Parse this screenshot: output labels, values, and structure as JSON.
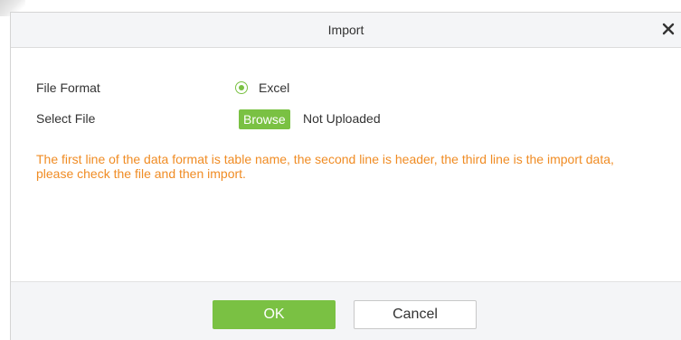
{
  "dialog": {
    "title": "Import",
    "close_icon": "close-icon"
  },
  "form": {
    "file_format_label": "File Format",
    "file_format_option": "Excel",
    "file_format_selected": true,
    "select_file_label": "Select File",
    "browse_label": "Browse",
    "upload_status": "Not Uploaded"
  },
  "notice": "The first line of the data format is table name, the second line is header, the third line is the import data, please check the file and then import.",
  "footer": {
    "ok_label": "OK",
    "cancel_label": "Cancel"
  },
  "colors": {
    "accent": "#7ac143",
    "notice": "#f08c24",
    "header_bg": "#f4f5f7"
  }
}
